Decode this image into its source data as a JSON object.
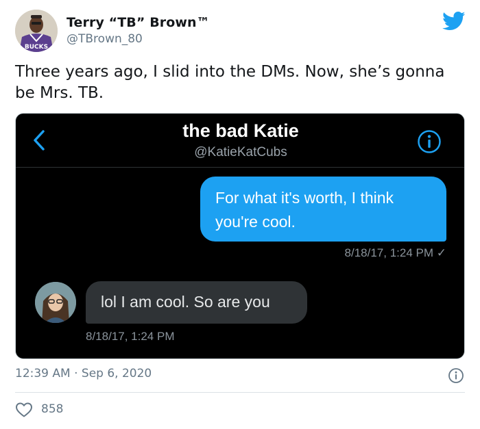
{
  "author": {
    "name": "Terry “TB” Brown™",
    "handle": "@TBrown_80",
    "jersey_text": "BUCKS"
  },
  "tweet": {
    "text": "Three years ago, I slid into the DMs. Now, she’s gonna be Mrs. TB.",
    "timestamp": "12:39 AM · Sep 6, 2020",
    "like_count": "858"
  },
  "dm": {
    "contact_name": "the bad Katie",
    "contact_handle": "@KatieKatCubs",
    "messages": [
      {
        "direction": "sent",
        "text": "For what it's worth, I think you're cool.",
        "time": "8/18/17, 1:24 PM ✓"
      },
      {
        "direction": "received",
        "text": "lol I am cool. So are you",
        "time": "8/18/17, 1:24 PM"
      }
    ]
  },
  "icons": {
    "brand": "twitter-bird-icon",
    "back": "chevron-left-icon",
    "info": "info-icon",
    "like": "heart-icon"
  },
  "colors": {
    "twitter_blue": "#1da1f2",
    "sent_bubble": "#1da1f2",
    "received_bubble": "#2f3336",
    "dm_background": "#000000",
    "secondary_text": "#657786"
  }
}
